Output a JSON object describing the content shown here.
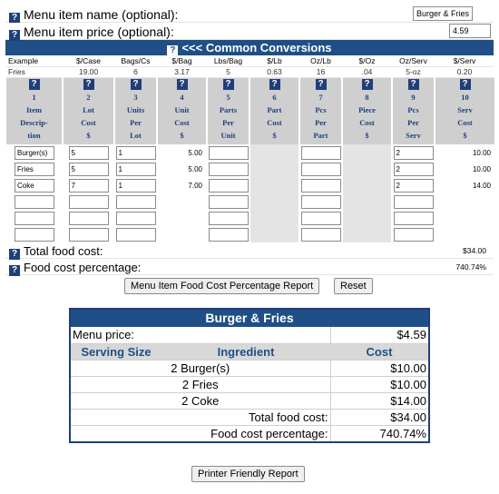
{
  "menu_item": {
    "name_label": "Menu item name (optional):",
    "name_value": "Burger & Fries",
    "price_label": "Menu item price (optional):",
    "price_value": "4.59"
  },
  "conversions": {
    "title": "<<< Common Conversions",
    "headers": [
      "Example",
      "$/Case",
      "Bags/Cs",
      "$/Bag",
      "Lbs/Bag",
      "$/Lb",
      "Oz/Lb",
      "$/Oz",
      "Oz/Serv",
      "$/Serv"
    ],
    "values": [
      "Fries",
      "19.00",
      "6",
      "3.17",
      "5",
      "0.63",
      "16",
      ".04",
      "5-oz",
      "0.20"
    ]
  },
  "columns": [
    {
      "num": "1",
      "label": [
        "Item",
        "Descrip-",
        "tion"
      ]
    },
    {
      "num": "2",
      "label": [
        "Lot",
        "Cost",
        "$"
      ]
    },
    {
      "num": "3",
      "label": [
        "Units",
        "Per",
        "Lot"
      ]
    },
    {
      "num": "4",
      "label": [
        "Unit",
        "Cost",
        "$"
      ]
    },
    {
      "num": "5",
      "label": [
        "Parts",
        "Per",
        "Unit"
      ]
    },
    {
      "num": "6",
      "label": [
        "Part",
        "Cost",
        "$"
      ]
    },
    {
      "num": "7",
      "label": [
        "Pcs",
        "Per",
        "Part"
      ]
    },
    {
      "num": "8",
      "label": [
        "Piece",
        "Cost",
        "$"
      ]
    },
    {
      "num": "9",
      "label": [
        "Pcs",
        "Per",
        "Serv"
      ]
    },
    {
      "num": "10",
      "label": [
        "Serv",
        "Cost",
        "$"
      ]
    }
  ],
  "rows": [
    {
      "desc": "Burger(s)",
      "lot_cost": "5",
      "units_per_lot": "1",
      "unit_cost": "5.00",
      "parts_per_unit": "",
      "pcs_per_part": "",
      "pcs_per_serv": "2",
      "serv_cost": "10.00"
    },
    {
      "desc": "Fries",
      "lot_cost": "5",
      "units_per_lot": "1",
      "unit_cost": "5.00",
      "parts_per_unit": "",
      "pcs_per_part": "",
      "pcs_per_serv": "2",
      "serv_cost": "10.00"
    },
    {
      "desc": "Coke",
      "lot_cost": "7",
      "units_per_lot": "1",
      "unit_cost": "7.00",
      "parts_per_unit": "",
      "pcs_per_part": "",
      "pcs_per_serv": "2",
      "serv_cost": "14.00"
    },
    {
      "desc": "",
      "lot_cost": "",
      "units_per_lot": "",
      "unit_cost": "",
      "parts_per_unit": "",
      "pcs_per_part": "",
      "pcs_per_serv": "",
      "serv_cost": ""
    },
    {
      "desc": "",
      "lot_cost": "",
      "units_per_lot": "",
      "unit_cost": "",
      "parts_per_unit": "",
      "pcs_per_part": "",
      "pcs_per_serv": "",
      "serv_cost": ""
    },
    {
      "desc": "",
      "lot_cost": "",
      "units_per_lot": "",
      "unit_cost": "",
      "parts_per_unit": "",
      "pcs_per_part": "",
      "pcs_per_serv": "",
      "serv_cost": ""
    }
  ],
  "totals": {
    "food_cost_label": "Total food cost:",
    "food_cost_value": "$34.00",
    "pct_label": "Food cost percentage:",
    "pct_value": "740.74%"
  },
  "buttons": {
    "report": "Menu Item Food Cost Percentage Report",
    "reset": "Reset",
    "print": "Printer Friendly Report"
  },
  "report": {
    "title": "Burger & Fries",
    "menu_price_label": "Menu price:",
    "menu_price_value": "$4.59",
    "headers": [
      "Serving Size",
      "Ingredient",
      "Cost"
    ],
    "items": [
      {
        "line": "2 Burger(s)",
        "cost": "$10.00"
      },
      {
        "line": "2 Fries",
        "cost": "$10.00"
      },
      {
        "line": "2 Coke",
        "cost": "$14.00"
      }
    ],
    "total_label": "Total food cost:",
    "total_value": "$34.00",
    "pct_label": "Food cost percentage:",
    "pct_value": "740.74%"
  },
  "colors": {
    "header_blue": "#1f4f86",
    "grey": "#cfcfcf"
  }
}
